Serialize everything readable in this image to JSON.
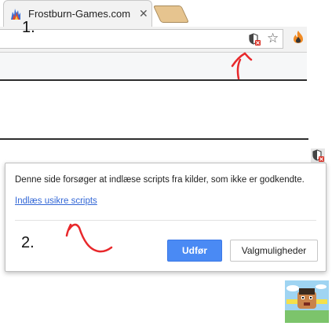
{
  "browser": {
    "tab": {
      "title": "Frostburn-Games.com",
      "close_glyph": "✕",
      "favicon": "frostburn-flame-icon"
    },
    "toolbar": {
      "star_glyph": "☆",
      "shield_icon": "blocked-content-shield-icon",
      "extension_icon": "flame-extension-icon"
    }
  },
  "annotations": {
    "step1": "1.",
    "step2": "2."
  },
  "popup": {
    "message": "Denne side forsøger at indlæse scripts fra kilder, som ikke er godkendte.",
    "link_label": "Indlæs usikre scripts",
    "primary_button": "Udfør",
    "secondary_button": "Valgmuligheder"
  },
  "colors": {
    "accent_blue": "#4a8af4",
    "link_blue": "#3367d6",
    "annotation_red": "#e8282b"
  }
}
